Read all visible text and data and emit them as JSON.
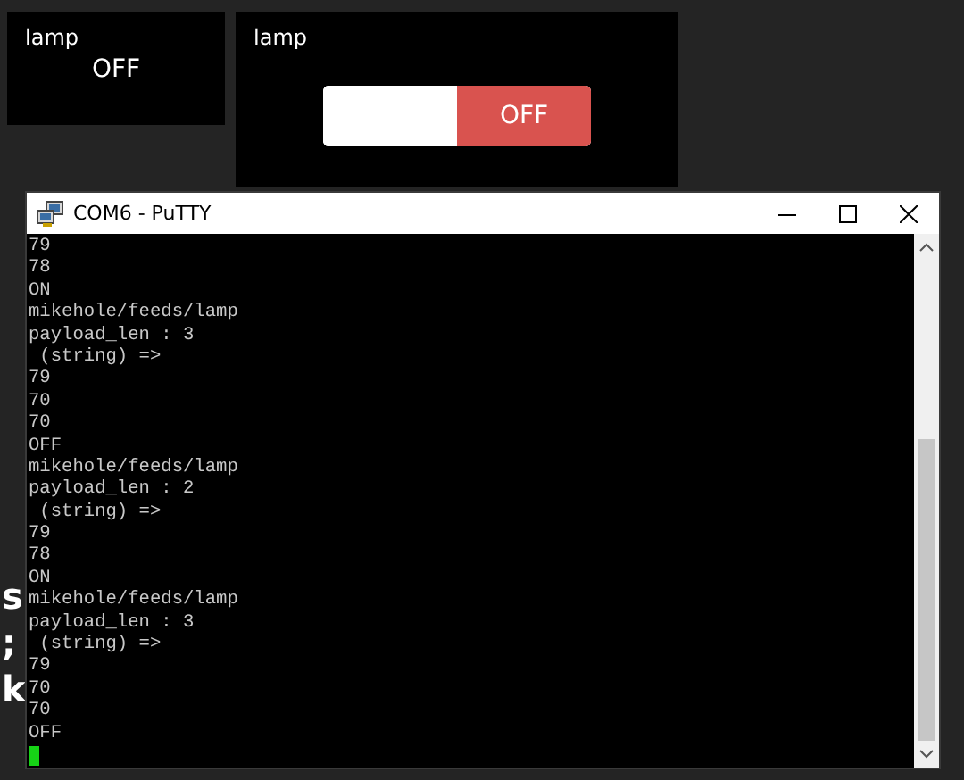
{
  "dashboard": {
    "blocks": [
      {
        "kind": "text",
        "title": "lamp",
        "value": "OFF"
      },
      {
        "kind": "toggle",
        "title": "lamp",
        "label": "OFF",
        "on": false
      }
    ]
  },
  "background_text": {
    "fragments": [
      "s",
      ";",
      "k"
    ]
  },
  "terminal": {
    "title": "COM6 - PuTTY",
    "cursor": true,
    "lines": [
      "79",
      "78",
      "ON",
      "mikehole/feeds/lamp",
      "payload_len : 3",
      " (string) =>",
      "79",
      "70",
      "70",
      "OFF",
      "mikehole/feeds/lamp",
      "payload_len : 2",
      " (string) =>",
      "79",
      "78",
      "ON",
      "mikehole/feeds/lamp",
      "payload_len : 3",
      " (string) =>",
      "79",
      "70",
      "70",
      "OFF"
    ]
  }
}
